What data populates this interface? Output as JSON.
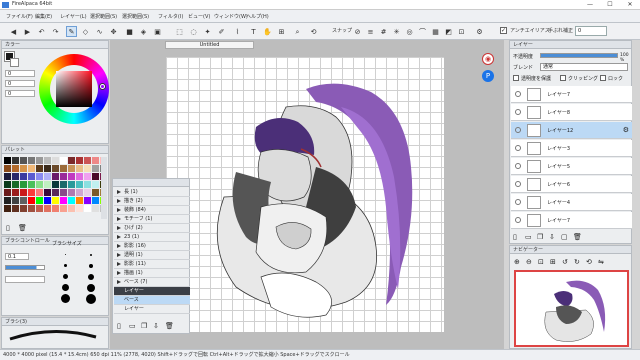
{
  "window": {
    "title": "FireAlpaca 64bit",
    "controls": [
      "—",
      "☐",
      "✕"
    ]
  },
  "menu": [
    "ファイル(F)",
    "編集(E)",
    "レイヤー(L)",
    "選択範囲(S)",
    "選択範囲(S)",
    "フィルタ(I)",
    "ビュー(V)",
    "ウィンドウ(W)",
    "ヘルプ(H)"
  ],
  "toolbar": {
    "snap_label": "スナップ",
    "antialias_label": "アンチエイリアス",
    "correction_label": "手ぶれ補正",
    "correction_value": "0"
  },
  "color_panel": {
    "title": "カラー",
    "values": [
      "0",
      "0",
      "0"
    ]
  },
  "palette_panel": {
    "title": "パレット"
  },
  "brush_control": {
    "title": "ブラシコントロール",
    "size_value": "0.1",
    "preset_title": "ブラシサイズ"
  },
  "brush_panel": {
    "title": "ブラシ(3)"
  },
  "document": {
    "tab": "Untitled"
  },
  "layer_panel": {
    "title": "レイヤー",
    "opacity_label": "不透明度",
    "opacity_value": "100 %",
    "blend_label": "ブレンド",
    "blend_value": "通常",
    "protect_label": "透明度を保護",
    "clipping_label": "クリッピング",
    "lock_label": "ロック",
    "layers": [
      "レイヤー7",
      "レイヤー8",
      "レイヤー12",
      "レイヤー3",
      "レイヤー5",
      "レイヤー6",
      "レイヤー4",
      "レイヤー7"
    ]
  },
  "floating_layers": [
    "長 (1)",
    "描き (2)",
    "装飾 (84)",
    "モチーフ (1)",
    "ひげ (2)",
    "23 (1)",
    "影影 (16)",
    "透明 (1)",
    "影影 (11)",
    "描画 (1)",
    "ベース (7)",
    "レイヤー",
    "ベース",
    "レイヤー"
  ],
  "navigator": {
    "title": "ナビゲーター"
  },
  "status": {
    "text": "4000 * 4000 pixel   (15.4 * 15.4cm)   650 dpi   11%   (2778, 4020)   Shift+ドラッグで回転   Ctrl+Alt+ドラッグで拡大縮小   Space+ドラッグでスクロール"
  },
  "colors": {
    "hair": "#8a5bb6",
    "accent": "#6f9fd6",
    "selected": "#bcd9f5"
  }
}
